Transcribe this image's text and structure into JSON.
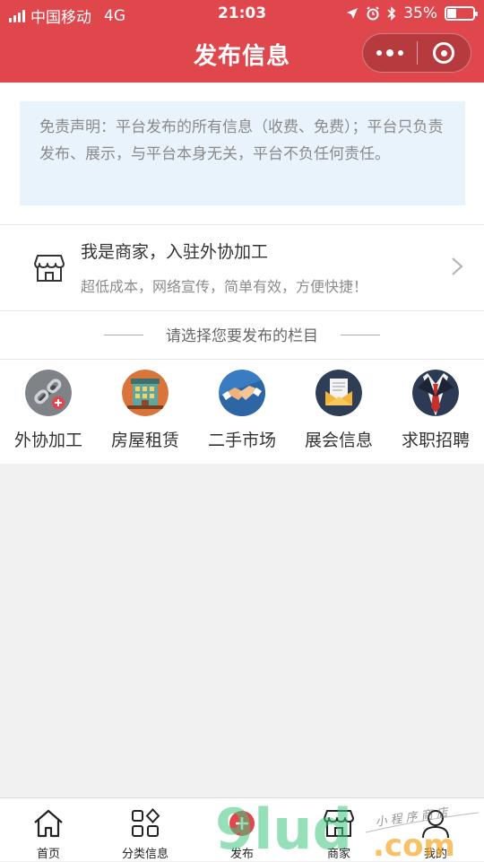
{
  "status_bar": {
    "carrier": "中国移动",
    "network": "4G",
    "time": "21:03",
    "battery_percent": "35%",
    "battery_level": 0.35
  },
  "nav": {
    "title": "发布信息",
    "more_icon": "more-dots-icon",
    "close_icon": "close-circle-icon"
  },
  "disclaimer": {
    "text": "免责声明：平台发布的所有信息（收费、免费）；平台只负责发布、展示，与平台本身无关，平台不负任何责任。"
  },
  "merchant": {
    "title": "我是商家，入驻外协加工",
    "subtitle": "超低成本，网络宣传，简单有效，方便快捷！",
    "icon": "shop-icon"
  },
  "section": {
    "title": "请选择您要发布的栏目"
  },
  "categories": [
    {
      "label": "外协加工",
      "icon": "chain-link-icon",
      "color": "#7d8186"
    },
    {
      "label": "房屋租赁",
      "icon": "building-icon",
      "color": "#d9743a"
    },
    {
      "label": "二手市场",
      "icon": "handshake-icon",
      "color": "#3a7cc4"
    },
    {
      "label": "展会信息",
      "icon": "envelope-icon",
      "color": "#2f3d55"
    },
    {
      "label": "求职招聘",
      "icon": "suit-icon",
      "color": "#2d3a54"
    }
  ],
  "tabbar": [
    {
      "label": "首页",
      "icon": "home-icon"
    },
    {
      "label": "分类信息",
      "icon": "grid-icon"
    },
    {
      "label": "发布",
      "icon": "publish-icon"
    },
    {
      "label": "商家",
      "icon": "shop-icon"
    },
    {
      "label": "我的",
      "icon": "user-icon"
    }
  ],
  "watermark": {
    "text": "9lud.com",
    "handwriting": "小程序商店"
  },
  "colors": {
    "brand": "#e0474d",
    "disclaimer_bg": "#e9f3fc",
    "page_bg": "#f1f1f1"
  }
}
